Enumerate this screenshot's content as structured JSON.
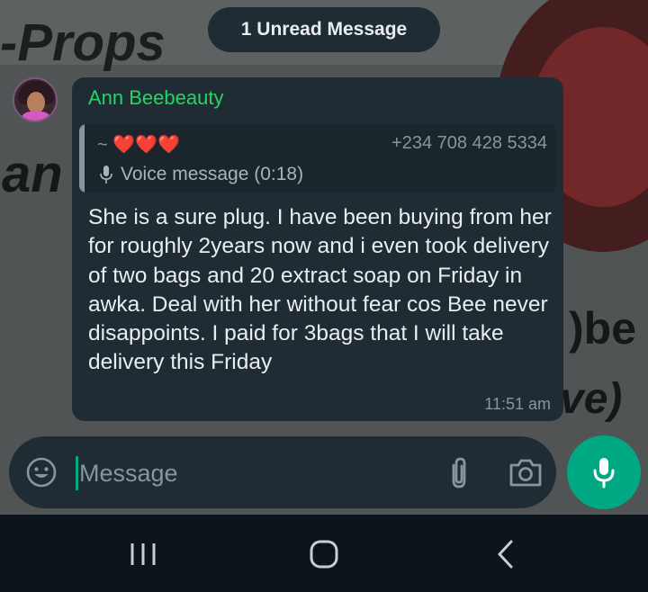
{
  "unread_banner": "1 Unread Message",
  "background_text": {
    "line1": "-Props",
    "line2": "an",
    "line3": ")be",
    "line4": "ve)"
  },
  "message": {
    "sender": "Ann Beebeauty",
    "sender_color": "#25d366",
    "quoted": {
      "name_prefix": "~ ",
      "name_emoji": "❤️❤️❤️",
      "phone": "+234 708 428 5334",
      "icon": "mic-icon",
      "text": "Voice message (0:18)"
    },
    "body": "She is a sure plug. I have been buying from her for roughly 2years now and i even took delivery of two bags and 20 extract soap on Friday in awka. Deal with her without fear cos Bee never disappoints. I paid for 3bags that I will take delivery this Friday",
    "time": "11:51 am"
  },
  "composer": {
    "placeholder": "Message",
    "emoji_icon": "emoji-icon",
    "attach_icon": "paperclip-icon",
    "camera_icon": "camera-icon",
    "mic_icon": "mic-icon",
    "accent": "#00a884"
  },
  "system_nav": {
    "recents": "recents-icon",
    "home": "home-icon",
    "back": "back-icon"
  }
}
